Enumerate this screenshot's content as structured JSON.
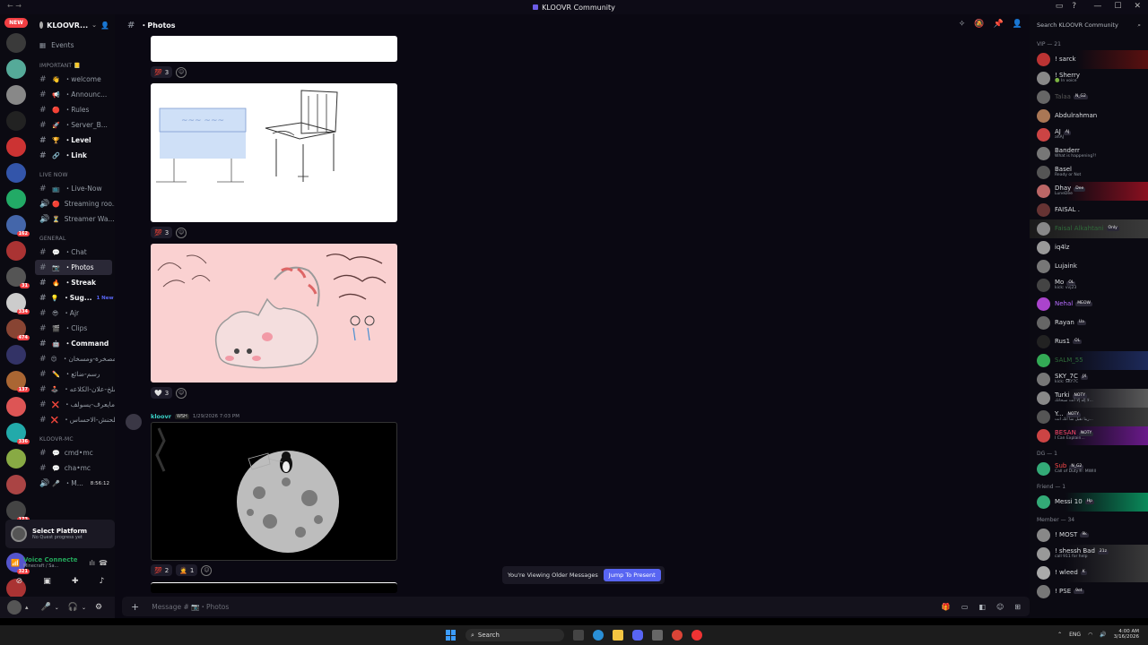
{
  "window": {
    "title": "KLOOVR Community"
  },
  "rail": {
    "new_badge": "NEW",
    "rena_label": "RENA"
  },
  "server": {
    "name": "KLOOVR...",
    "events_label": "Events",
    "categories": {
      "important": "IMPORTANT 📒",
      "live_now": "LIVE NOW",
      "general": "GENERAL",
      "kloovr_mc": "KLOOVR-MC"
    },
    "important_channels": [
      {
        "emoji": "👋",
        "label": "・welcome"
      },
      {
        "emoji": "📢",
        "label": "・Announc..."
      },
      {
        "emoji": "🔴",
        "label": "・Rules"
      },
      {
        "emoji": "🚀",
        "label": "・Server_B..."
      },
      {
        "emoji": "🏆",
        "label": "・Level"
      },
      {
        "emoji": "🔗",
        "label": "・Link"
      }
    ],
    "live_channels": [
      {
        "emoji": "📺",
        "label": "・Live-Now"
      },
      {
        "emoji": "🔴",
        "label": "Streaming roo..."
      },
      {
        "emoji": "⏳",
        "label": "Streamer Wa..."
      }
    ],
    "general_channels": [
      {
        "emoji": "💬",
        "label": "・Chat"
      },
      {
        "emoji": "📷",
        "label": "・Photos"
      },
      {
        "emoji": "🔥",
        "label": "・Streak"
      },
      {
        "emoji": "💡",
        "label": "・Sug...",
        "tag": "1 New"
      },
      {
        "emoji": "😎",
        "label": "・Ajr"
      },
      {
        "emoji": "🎬",
        "label": "・Clips"
      },
      {
        "emoji": "🤖",
        "label": "・Command"
      },
      {
        "emoji": "😍",
        "label": "・مصخرة-ومسخان"
      },
      {
        "emoji": "✏️",
        "label": "・رسم-ضائع"
      },
      {
        "emoji": "🕹️",
        "label": "・شلخ-علان-الكلاعه"
      },
      {
        "emoji": "❌",
        "label": "・مايعرف-يسولف"
      },
      {
        "emoji": "❌",
        "label": "・ملحنش-الاحساس"
      }
    ],
    "mc_channels": [
      {
        "emoji": "💬",
        "label": "cmd•mc"
      },
      {
        "emoji": "💬",
        "label": "cha•mc"
      },
      {
        "emoji": "🎤",
        "label": "・M...",
        "time": "8:56:12"
      }
    ]
  },
  "quest": {
    "title": "Select Platform",
    "subtitle": "No Quest progress yet"
  },
  "voice": {
    "title": "Voice Connecte",
    "subtitle": "Minecraft / Sa..."
  },
  "channel_header": {
    "name": "・Photos"
  },
  "reactions": [
    {
      "emoji": "💯",
      "count": "3"
    },
    {
      "emoji": "💯",
      "count": "3"
    },
    {
      "emoji": "🤍",
      "count": "3"
    }
  ],
  "message": {
    "author": "kloovr",
    "tag": "WSH",
    "time": "1/29/2026 7:03 PM",
    "reactions": [
      {
        "emoji": "💯",
        "count": "2"
      },
      {
        "emoji": "🤦",
        "count": "1"
      }
    ]
  },
  "older_notice": {
    "text": "You're Viewing Older Messages",
    "button": "Jump To Present"
  },
  "composer": {
    "placeholder": "Message # 📷・Photos"
  },
  "members_search": "Search KLOOVR Community",
  "member_groups": [
    {
      "title": "VIP — 21",
      "members": [
        {
          "name": "! sarck",
          "status": "",
          "color": "#dbdee1",
          "bg": "linear-gradient(90deg, transparent 40%, #5a1010)"
        },
        {
          "name": "! Sherry",
          "status": "🟢 In voice",
          "color": "#dbdee1",
          "bg": ""
        },
        {
          "name": "Talaa",
          "tag": "N_G2",
          "status": "",
          "color": "#555",
          "bg": ""
        },
        {
          "name": "Abdulrahman",
          "status": "",
          "color": "#dbdee1",
          "bg": ""
        },
        {
          "name": "AJ",
          "tag": "AJ",
          "status": "ahAJ",
          "color": "#dbdee1",
          "bg": ""
        },
        {
          "name": "Banderr",
          "status": "What is happening?!",
          "color": "#dbdee1",
          "bg": ""
        },
        {
          "name": "Basel",
          "status": "Ready or Not",
          "color": "#dbdee1",
          "bg": ""
        },
        {
          "name": "Dhay",
          "tag": "Dee",
          "status": "LuneDee",
          "color": "#dbdee1",
          "bg": "linear-gradient(90deg, transparent 30%, #8a1020)"
        },
        {
          "name": "FAISAL .",
          "status": "",
          "color": "#dbdee1",
          "bg": ""
        },
        {
          "name": "Faisal Alkahtani",
          "tag": "Only",
          "status": "",
          "color": "#2f6b3a",
          "bg": "linear-gradient(90deg, #1a1a1a, #3a3a3a)"
        },
        {
          "name": "iq4lz",
          "status": "",
          "color": "#dbdee1",
          "bg": ""
        },
        {
          "name": "Lujaink",
          "status": "",
          "color": "#dbdee1",
          "bg": ""
        },
        {
          "name": "Mo",
          "tag": "OL",
          "status": "kick: vvj23",
          "color": "#dbdee1",
          "bg": ""
        },
        {
          "name": "Nehal",
          "tag": "MEOW",
          "status": "",
          "color": "#b66cff",
          "bg": ""
        },
        {
          "name": "Rayan",
          "tag": "Ua",
          "status": "",
          "color": "#dbdee1",
          "bg": ""
        },
        {
          "name": "Rus1",
          "tag": "OL",
          "status": "",
          "color": "#dbdee1",
          "bg": ""
        },
        {
          "name": "SALM_55",
          "status": "",
          "color": "#2f6b3a",
          "bg": "linear-gradient(90deg, transparent 30%, #1d2a5a)"
        },
        {
          "name": "SKY_7C",
          "tag": "JX",
          "status": "kick: SKY7C",
          "color": "#dbdee1",
          "bg": ""
        },
        {
          "name": "Turki",
          "tag": "NOTY",
          "status": "لا إله إلا أنت سبحانك...",
          "color": "#dbdee1",
          "bg": "linear-gradient(90deg, transparent 30%, #5a5a5a)"
        },
        {
          "name": "Y...",
          "tag": "NOTY",
          "status": "ربنا تقبل منا انك انت...",
          "color": "#dbdee1",
          "bg": "linear-gradient(90deg, transparent 30%, #3a3a3a)"
        },
        {
          "name": "BESAN",
          "tag": "NOTY",
          "status": "I Can Explain...",
          "color": "#ff4b6e",
          "bg": "linear-gradient(90deg, transparent 30%, #6a1a8a)"
        }
      ]
    },
    {
      "title": "DG — 1",
      "members": [
        {
          "name": "Sub",
          "tag": "N_G2",
          "status": "Call of Duty®: MWIII",
          "color": "#ff4b4b",
          "bg": ""
        }
      ]
    },
    {
      "title": "Friend — 1",
      "members": [
        {
          "name": "Messi 10",
          "tag": "Hp",
          "status": "",
          "color": "#dbdee1",
          "bg": "linear-gradient(90deg, transparent 30%, #0a8a5a)"
        }
      ]
    },
    {
      "title": "Member — 34",
      "members": [
        {
          "name": "! MOST",
          "tag": "9k",
          "status": "",
          "color": "#dbdee1",
          "bg": ""
        },
        {
          "name": "! shessh Bad",
          "tag": "21z",
          "status": "call 911 for help",
          "color": "#dbdee1",
          "bg": "linear-gradient(90deg, transparent 30%, #3a3a3a)"
        },
        {
          "name": "! wleed",
          "tag": "K",
          "status": "",
          "color": "#dbdee1",
          "bg": "linear-gradient(90deg, transparent 30%, #3a3a3a)"
        },
        {
          "name": "! PSE",
          "tag": "9et",
          "status": "",
          "color": "#dbdee1",
          "bg": ""
        }
      ]
    }
  ],
  "taskbar": {
    "search": "Search",
    "lang": "ENG",
    "time": "4:00 AM",
    "date": "3/16/2026"
  },
  "colors": {
    "accent": "#5865f2",
    "bg_main": "#0a0812",
    "bg_side": "#0b0a12"
  }
}
